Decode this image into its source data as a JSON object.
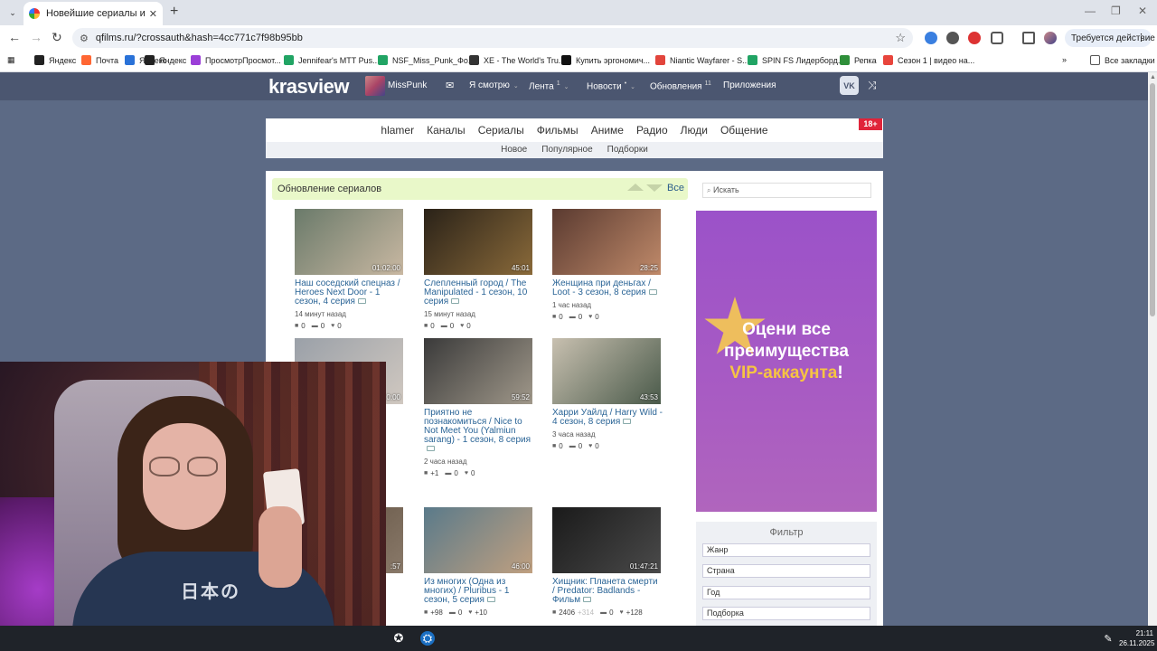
{
  "browser": {
    "tab_title": "Новейшие сериалы и фильмы",
    "url": "qfilms.ru/?crossauth&hash=4cc771c7f98b95bb",
    "action_label": "Требуется действие",
    "bookmarks": [
      {
        "label": "Яндекс",
        "color": "#222222"
      },
      {
        "label": "Почта",
        "color": "#ff6633"
      },
      {
        "label": "Яндекс",
        "color": "#2a72d8"
      },
      {
        "label": "Яндекс",
        "color": "#222222"
      },
      {
        "label": "ПросмотрПросмот...",
        "color": "#9b3fd8"
      },
      {
        "label": "Jennifear's MTT Pus...",
        "color": "#21a464"
      },
      {
        "label": "NSF_Miss_Punk_Фо...",
        "color": "#21a464"
      },
      {
        "label": "XE - The World's Tru...",
        "color": "#333333"
      },
      {
        "label": "Купить эргономич...",
        "color": "#111111"
      },
      {
        "label": "Niantic Wayfarer - S...",
        "color": "#e2453c"
      },
      {
        "label": "SPIN FS Лидерборд...",
        "color": "#21a464"
      },
      {
        "label": "Репка",
        "color": "#2f8f3a"
      },
      {
        "label": "Сезон 1 | видео на...",
        "color": "#e8453c"
      }
    ],
    "all_bookmarks": "Все закладки"
  },
  "header": {
    "logo": "krasview",
    "username": "MissPunk",
    "menu": {
      "watching": "Я смотрю",
      "feed": "Лента",
      "feed_count": "1",
      "news": "Новости",
      "news_badge": "•",
      "updates": "Обновления",
      "updates_count": "11",
      "apps": "Приложения"
    },
    "vk": "VK"
  },
  "nav": {
    "main": [
      "hlamer",
      "Каналы",
      "Сериалы",
      "Фильмы",
      "Аниме",
      "Радио",
      "Люди",
      "Общение"
    ],
    "sub": [
      "Новое",
      "Популярное",
      "Подборки"
    ],
    "age": "18+"
  },
  "section": {
    "title": "Обновление сериалов",
    "all": "Все"
  },
  "cards": [
    {
      "title": "Наш соседский спецназ / Heroes Next Door - 1 сезон, 4 серия",
      "duration": "01:02:00",
      "time": "14 минут назад",
      "views": "0",
      "comments": "0",
      "likes": "0",
      "colors": [
        "#6a7a6a",
        "#c9b8a2"
      ]
    },
    {
      "title": "Слепленный город / The Manipulated - 1 сезон, 10 серия",
      "duration": "45:01",
      "time": "15 минут назад",
      "views": "0",
      "comments": "0",
      "likes": "0",
      "colors": [
        "#2a2218",
        "#8a6a3a"
      ]
    },
    {
      "title": "Женщина при деньгах / Loot - 3 сезон, 8 серия",
      "duration": "28:25",
      "time": "1 час назад",
      "views": "0",
      "comments": "0",
      "likes": "0",
      "colors": [
        "#5a3a30",
        "#c08a6a"
      ]
    },
    {
      "title": "",
      "duration": "0:00",
      "time": "",
      "views": "",
      "comments": "",
      "likes": "",
      "colors": [
        "#9aa0a8",
        "#d0c8c0"
      ]
    },
    {
      "title": "Приятно не познакомиться / Nice to Not Meet You (Yalmiun sarang) - 1 сезон, 8 серия",
      "duration": "59:52",
      "time": "2 часа назад",
      "views": "+1",
      "comments": "0",
      "likes": "0",
      "colors": [
        "#3a3a3a",
        "#a0988a"
      ]
    },
    {
      "title": "Харри Уайлд / Harry Wild - 4 сезон, 8 серия",
      "duration": "43:53",
      "time": "3 часа назад",
      "views": "0",
      "comments": "0",
      "likes": "0",
      "colors": [
        "#c8c0b0",
        "#4a5a4a"
      ]
    },
    {
      "title": "ery",
      "duration": ":57",
      "time": "",
      "views": "",
      "comments": "",
      "likes": "",
      "colors": [
        "#5a4a3a",
        "#8a7a6a"
      ]
    },
    {
      "title": "Из многих (Одна из многих) / Pluribus - 1 сезон, 5 серия",
      "duration": "46:00",
      "time": "",
      "views": "+98",
      "comments": "0",
      "likes": "+10",
      "colors": [
        "#5a7a8a",
        "#c0a080"
      ]
    },
    {
      "title": "Хищник: Планета смерти / Predator: Badlands - Фильм",
      "duration": "01:47:21",
      "time": "",
      "views": "2406",
      "views_extra": "+314",
      "comments": "0",
      "likes": "+128",
      "colors": [
        "#1a1a1a",
        "#4a4a4a"
      ]
    }
  ],
  "sidebar": {
    "search_placeholder": "Искать",
    "vip_line1": "Оцени все",
    "vip_line2": "преимущества",
    "vip_line3": "VIP-аккаунта",
    "vip_excl": "!",
    "filter_title": "Фильтр",
    "filters": [
      "Жанр",
      "Страна",
      "Год",
      "Подборка"
    ]
  },
  "webcam": {
    "shirt_text": "日本の"
  },
  "taskbar": {
    "time": "21:11",
    "date": "26.11.2025"
  }
}
